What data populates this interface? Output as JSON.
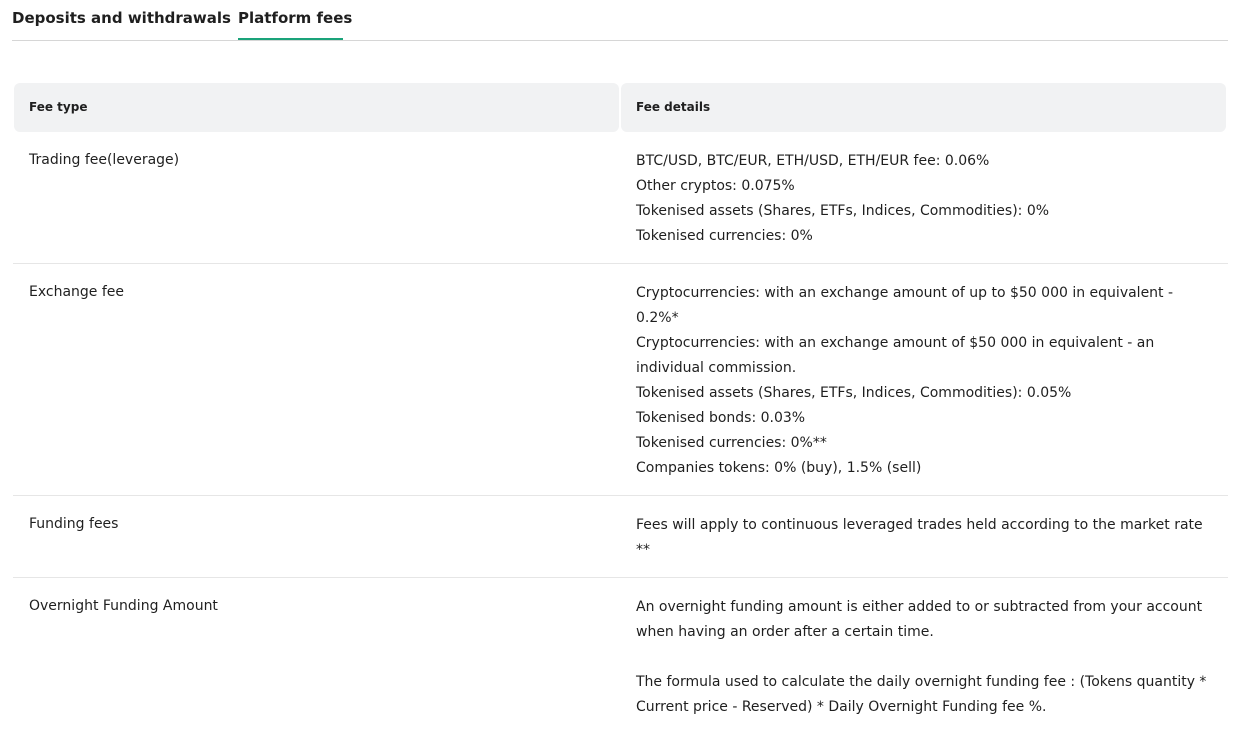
{
  "tabs": [
    {
      "label": "Deposits and withdrawals",
      "active": false
    },
    {
      "label": "Platform fees",
      "active": true
    }
  ],
  "accent_color": "#1aa37a",
  "table": {
    "headers": [
      "Fee type",
      "Fee details"
    ],
    "rows": [
      {
        "type": "Trading fee(leverage)",
        "details": [
          "BTC/USD, BTC/EUR, ETH/USD, ETH/EUR fee: 0.06%",
          "Other cryptos: 0.075%",
          "Tokenised assets (Shares, ETFs, Indices, Commodities): 0%",
          "Tokenised currencies: 0%"
        ]
      },
      {
        "type": "Exchange fee",
        "details": [
          "Cryptocurrencies: with an exchange amount of up to $50 000 in equivalent - 0.2%*",
          "Cryptocurrencies: with an exchange amount of $50 000 in equivalent - an individual commission.",
          "Tokenised assets (Shares, ETFs, Indices, Commodities): 0.05%",
          "Tokenised bonds: 0.03%",
          "Tokenised currencies: 0%**",
          "Companies tokens: 0% (buy), 1.5% (sell)"
        ]
      },
      {
        "type": "Funding fees",
        "details": [
          "Fees will apply to continuous leveraged trades held according to the market rate **"
        ]
      },
      {
        "type": "Overnight Funding Amount",
        "details": [
          "An overnight funding amount is either added to or subtracted from your account when having an order after a certain time.",
          "The formula used to calculate the daily overnight funding fee : (Tokens quantity * Current price - Reserved) * Daily Overnight Funding fee %."
        ]
      }
    ]
  }
}
